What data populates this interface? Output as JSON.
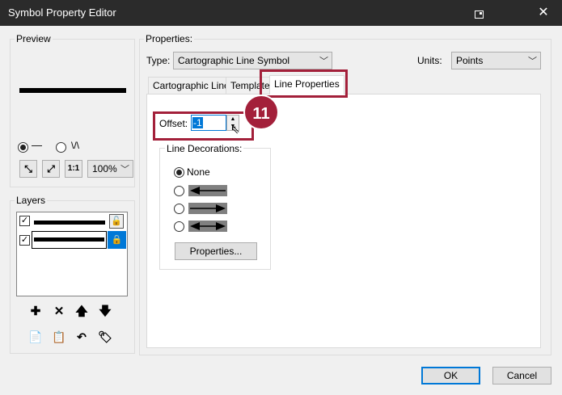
{
  "window": {
    "title": "Symbol Property Editor",
    "close_glyph": "✕"
  },
  "preview": {
    "label": "Preview",
    "zoom": "100%",
    "radio_solid_glyph": "—",
    "radio_wave_glyph": "\\/\\"
  },
  "layers": {
    "label": "Layers",
    "rows": [
      {
        "checked": true,
        "locked": false,
        "selected": false
      },
      {
        "checked": true,
        "locked": true,
        "selected": true
      }
    ],
    "buttons": [
      {
        "name": "add-layer-button",
        "glyph": "✚"
      },
      {
        "name": "remove-layer-button",
        "glyph": "✕"
      },
      {
        "name": "move-up-button",
        "glyph": "🡅"
      },
      {
        "name": "move-down-button",
        "glyph": "🡇"
      }
    ]
  },
  "properties": {
    "label": "Properties:",
    "type_label": "Type:",
    "type_value": "Cartographic Line Symbol",
    "units_label": "Units:",
    "units_value": "Points",
    "tabs": [
      {
        "label": "Cartographic Line",
        "active": false
      },
      {
        "label": "Template",
        "active": false
      },
      {
        "label": "Line Properties",
        "active": true
      }
    ],
    "offset_label": "Offset:",
    "offset_value": "-1",
    "decorations_label": "Line Decorations:",
    "decoration_none": "None",
    "properties_button": "Properties..."
  },
  "callout": {
    "number": "11",
    "color": "#a3203a"
  },
  "footer": {
    "ok": "OK",
    "cancel": "Cancel"
  }
}
